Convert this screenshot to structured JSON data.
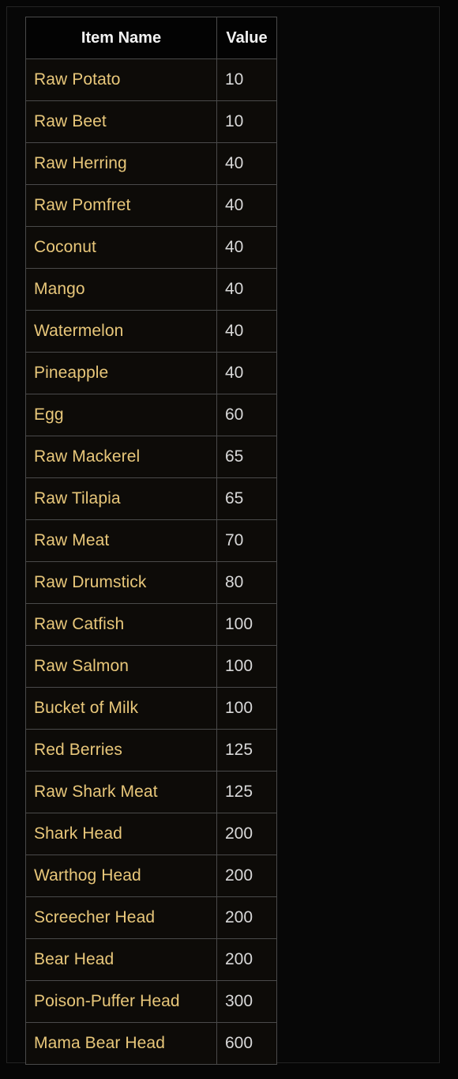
{
  "colors": {
    "page_background": "#060606",
    "frame_border": "#232323",
    "table_background": "#0d0b08",
    "header_background": "#030303",
    "grid_line": "#4a4a4a",
    "item_name_text": "#e8c77a",
    "value_text": "#d8d8d8",
    "header_text": "#f2f2f2"
  },
  "table": {
    "columns": [
      {
        "key": "item_name",
        "label": "Item Name",
        "align": "left"
      },
      {
        "key": "value",
        "label": "Value",
        "align": "left"
      }
    ],
    "row_count": 24,
    "rows": [
      {
        "item_name": "Raw Potato",
        "value": "10"
      },
      {
        "item_name": "Raw Beet",
        "value": "10"
      },
      {
        "item_name": "Raw Herring",
        "value": "40"
      },
      {
        "item_name": "Raw Pomfret",
        "value": "40"
      },
      {
        "item_name": "Coconut",
        "value": "40"
      },
      {
        "item_name": "Mango",
        "value": "40"
      },
      {
        "item_name": "Watermelon",
        "value": "40"
      },
      {
        "item_name": "Pineapple",
        "value": "40"
      },
      {
        "item_name": "Egg",
        "value": "60"
      },
      {
        "item_name": "Raw Mackerel",
        "value": "65"
      },
      {
        "item_name": "Raw Tilapia",
        "value": "65"
      },
      {
        "item_name": "Raw Meat",
        "value": "70"
      },
      {
        "item_name": "Raw Drumstick",
        "value": "80"
      },
      {
        "item_name": "Raw Catfish",
        "value": "100"
      },
      {
        "item_name": "Raw Salmon",
        "value": "100"
      },
      {
        "item_name": "Bucket of Milk",
        "value": "100"
      },
      {
        "item_name": "Red Berries",
        "value": "125"
      },
      {
        "item_name": "Raw Shark Meat",
        "value": "125"
      },
      {
        "item_name": "Shark Head",
        "value": "200"
      },
      {
        "item_name": "Warthog Head",
        "value": "200"
      },
      {
        "item_name": "Screecher Head",
        "value": "200"
      },
      {
        "item_name": "Bear Head",
        "value": "200"
      },
      {
        "item_name": "Poison-Puffer Head",
        "value": "300"
      },
      {
        "item_name": "Mama Bear Head",
        "value": "600"
      }
    ]
  }
}
